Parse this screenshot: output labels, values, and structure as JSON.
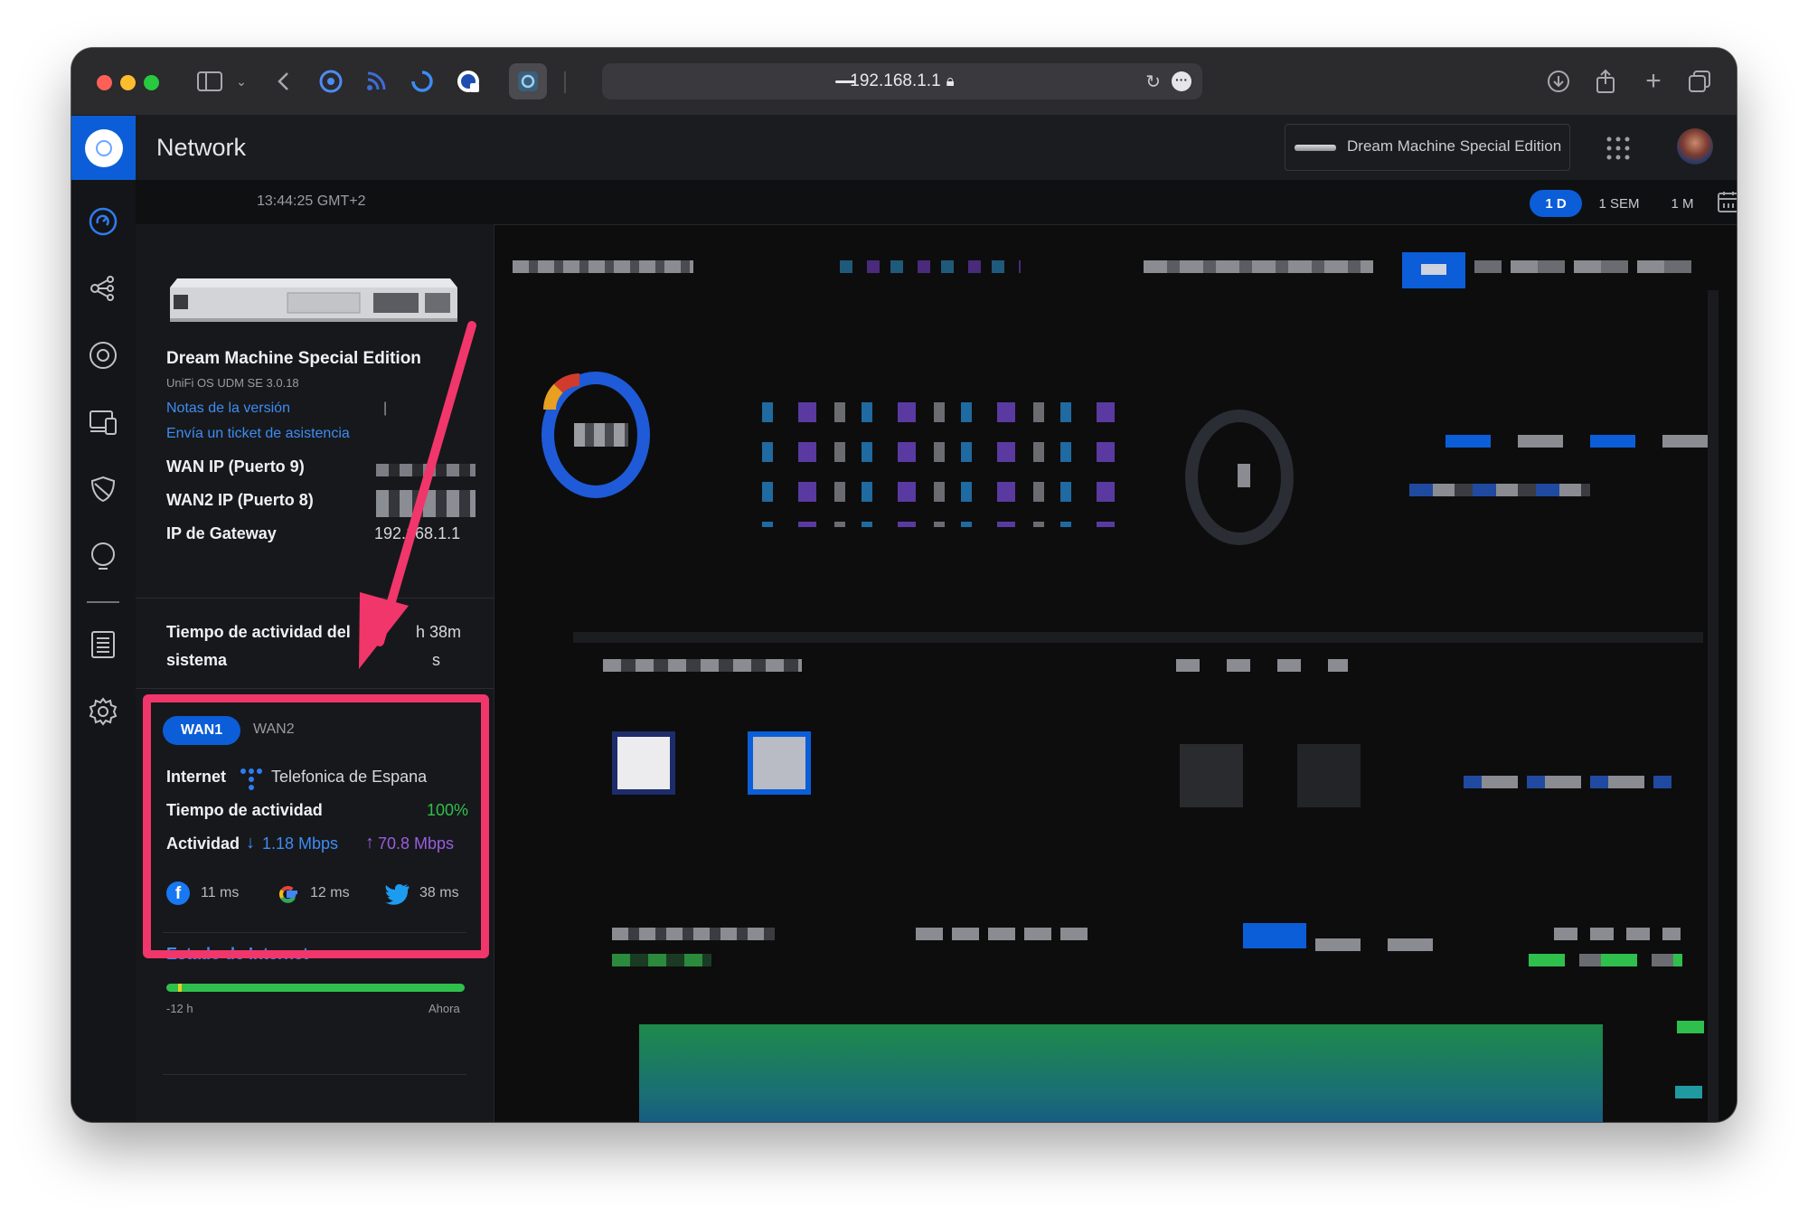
{
  "browser": {
    "address": "192.168.1.1",
    "icons": [
      "sidebar-icon",
      "chevron-down-icon",
      "back-icon",
      "extension-icon",
      "rss-icon",
      "loading-icon",
      "lock-badge-icon",
      "settings-extension-icon",
      "reload-icon",
      "more-icon",
      "download-icon",
      "share-icon",
      "plus-icon",
      "tabs-icon"
    ]
  },
  "app": {
    "title": "Network",
    "device_selector": "Dream Machine Special Edition"
  },
  "timebar": {
    "time": "13:44:25 GMT+2",
    "ranges": [
      "1 D",
      "1 SEM",
      "1 M"
    ],
    "selected": "1 D"
  },
  "device": {
    "name": "Dream Machine Special Edition",
    "os": "UniFi OS UDM SE 3.0.18",
    "release_notes": "Notas de la versión",
    "separator": "|",
    "support_ticket": "Envía un ticket de asistencia",
    "rows": [
      {
        "label": "WAN IP (Puerto 9)",
        "value": ""
      },
      {
        "label": "WAN2 IP (Puerto 8)",
        "value": ""
      },
      {
        "label": "IP de Gateway",
        "value": "192.168.1.1"
      }
    ],
    "uptime_label_1": "Tiempo de actividad del",
    "uptime_label_2": "sistema",
    "uptime_value_1": "h 38m",
    "uptime_value_2": "s"
  },
  "wan": {
    "tabs": [
      "WAN1",
      "WAN2"
    ],
    "internet_label": "Internet",
    "isp": "Telefonica de Espana",
    "uptime_label": "Tiempo de actividad",
    "uptime_value": "100%",
    "activity_label": "Actividad",
    "down": "1.18 Mbps",
    "up": "70.8 Mbps",
    "latencies": [
      {
        "service": "facebook",
        "value": "11 ms"
      },
      {
        "service": "google",
        "value": "12 ms"
      },
      {
        "service": "twitter",
        "value": "38 ms"
      }
    ]
  },
  "internet_status": {
    "title": "Estado de Internet",
    "start": "-12 h",
    "end": "Ahora"
  },
  "colors": {
    "accent": "#0b5ed8",
    "highlight": "#f0366a",
    "uptime": "#2fbf4c",
    "down": "#3d8cf4",
    "up": "#9a5de0"
  }
}
